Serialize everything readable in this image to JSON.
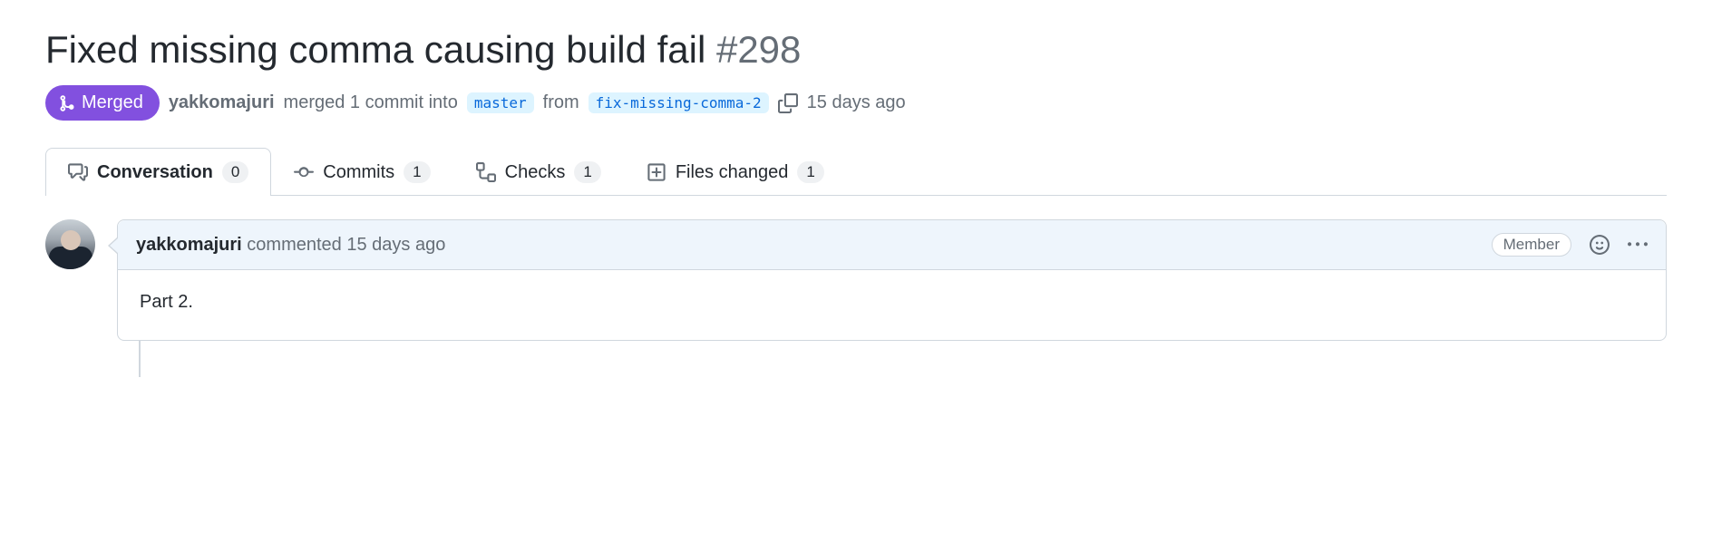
{
  "pr": {
    "title": "Fixed missing comma causing build fail",
    "number": "#298",
    "state": "Merged",
    "author": "yakkomajuri",
    "merge_text_1": "merged 1 commit into",
    "base_branch": "master",
    "merge_text_2": "from",
    "head_branch": "fix-missing-comma-2",
    "when": "15 days ago"
  },
  "tabs": {
    "conversation": {
      "label": "Conversation",
      "count": "0"
    },
    "commits": {
      "label": "Commits",
      "count": "1"
    },
    "checks": {
      "label": "Checks",
      "count": "1"
    },
    "files": {
      "label": "Files changed",
      "count": "1"
    }
  },
  "comment": {
    "author": "yakkomajuri",
    "action": "commented",
    "when": "15 days ago",
    "role_badge": "Member",
    "body": "Part 2."
  }
}
